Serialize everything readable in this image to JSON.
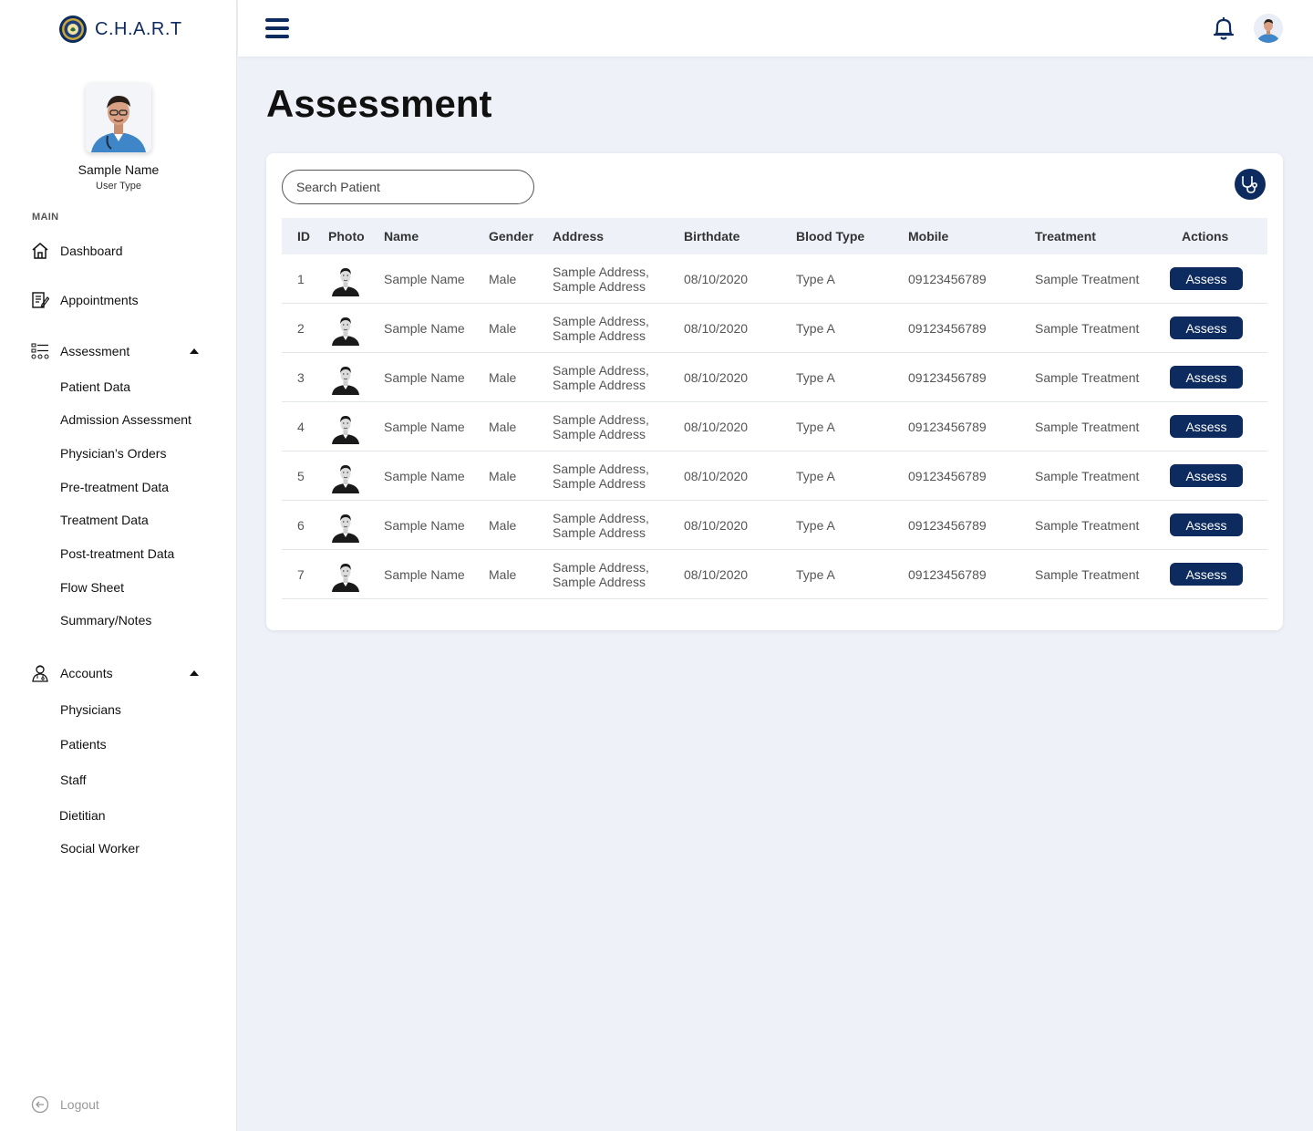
{
  "brand": {
    "name": "C.H.A.R.T"
  },
  "profile": {
    "name": "Sample Name",
    "user_type": "User Type"
  },
  "sidebar": {
    "section_label": "MAIN",
    "dashboard": "Dashboard",
    "appointments": "Appointments",
    "assessment": {
      "label": "Assessment",
      "items": [
        "Patient Data",
        "Admission Assessment",
        "Physician’s Orders",
        "Pre-treatment Data",
        "Treatment Data",
        "Post-treatment Data",
        "Flow Sheet",
        "Summary/Notes"
      ]
    },
    "accounts": {
      "label": "Accounts",
      "items": [
        "Physicians",
        "Patients",
        "Staff",
        "Dietitian",
        "Social Worker"
      ]
    },
    "logout": "Logout"
  },
  "page": {
    "title": "Assessment"
  },
  "search": {
    "placeholder": "Search Patient"
  },
  "table": {
    "headers": [
      "ID",
      "Photo",
      "Name",
      "Gender",
      "Address",
      "Birthdate",
      "Blood Type",
      "Mobile",
      "Treatment",
      "Actions"
    ],
    "action_label": "Assess",
    "rows": [
      {
        "id": "1",
        "name": "Sample Name",
        "gender": "Male",
        "address1": "Sample Address,",
        "address2": "Sample Address",
        "birthdate": "08/10/2020",
        "blood": "Type A",
        "mobile": "09123456789",
        "treatment": "Sample Treatment"
      },
      {
        "id": "2",
        "name": "Sample Name",
        "gender": "Male",
        "address1": "Sample Address,",
        "address2": "Sample Address",
        "birthdate": "08/10/2020",
        "blood": "Type A",
        "mobile": "09123456789",
        "treatment": "Sample Treatment"
      },
      {
        "id": "3",
        "name": "Sample Name",
        "gender": "Male",
        "address1": "Sample Address,",
        "address2": "Sample Address",
        "birthdate": "08/10/2020",
        "blood": "Type A",
        "mobile": "09123456789",
        "treatment": "Sample Treatment"
      },
      {
        "id": "4",
        "name": "Sample Name",
        "gender": "Male",
        "address1": "Sample Address,",
        "address2": "Sample Address",
        "birthdate": "08/10/2020",
        "blood": "Type A",
        "mobile": "09123456789",
        "treatment": "Sample Treatment"
      },
      {
        "id": "5",
        "name": "Sample Name",
        "gender": "Male",
        "address1": "Sample Address,",
        "address2": "Sample Address",
        "birthdate": "08/10/2020",
        "blood": "Type A",
        "mobile": "09123456789",
        "treatment": "Sample Treatment"
      },
      {
        "id": "6",
        "name": "Sample Name",
        "gender": "Male",
        "address1": "Sample Address,",
        "address2": "Sample Address",
        "birthdate": "08/10/2020",
        "blood": "Type A",
        "mobile": "09123456789",
        "treatment": "Sample Treatment"
      },
      {
        "id": "7",
        "name": "Sample Name",
        "gender": "Male",
        "address1": "Sample Address,",
        "address2": "Sample Address",
        "birthdate": "08/10/2020",
        "blood": "Type A",
        "mobile": "09123456789",
        "treatment": "Sample Treatment"
      }
    ]
  },
  "colors": {
    "primary": "#0d2b5e",
    "background": "#eef1f8",
    "header_row": "#eef1f8"
  },
  "icons": {
    "menu": "hamburger-icon",
    "notifications": "bell-icon",
    "stethoscope": "stethoscope-icon",
    "dashboard": "home-icon",
    "appointments": "clipboard-icon",
    "assessment": "checklist-icon",
    "accounts": "doctor-icon",
    "logout": "logout-icon"
  }
}
